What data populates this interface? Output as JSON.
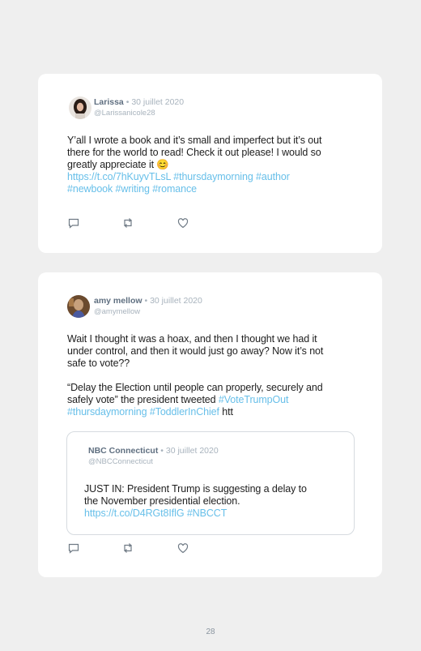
{
  "tweets": [
    {
      "author": "Larissa",
      "separator": "•",
      "date": "30 juillet 2020",
      "handle": "@Larissanicole28",
      "text_lines": [
        "Y’all I wrote a book and it’s small and imperfect but it’s out",
        "there for the world to read! Check it out please! I would so",
        "greatly appreciate it "
      ],
      "emoji": "😊",
      "link": "https://t.co/7hKuyvTLsL",
      "hashtags_line1": "#thursdaymorning #author",
      "hashtags_line2": "#newbook #writing #romance"
    },
    {
      "author": "amy mellow",
      "separator": "•",
      "date": "30 juillet 2020",
      "handle": "@amymellow",
      "text_lines": [
        "Wait I thought it was a hoax, and then I thought we had it",
        "under control, and then it would just go away? Now it’s not",
        "safe to vote??"
      ],
      "text2_line1": "“Delay the Election until people can properly, securely and",
      "text2_line2_start": "safely vote” the president tweeted ",
      "text2_hashtag1": "#VoteTrumpOut",
      "text2_hashtags_line3": "#thursdaymorning #ToddlerInChief",
      "text2_trailing": " htt",
      "quote": {
        "author": "NBC Connecticut",
        "separator": "•",
        "date": "30 juillet 2020",
        "handle": "@NBCConnecticut",
        "text_line1": "JUST IN: President Trump is suggesting a delay to",
        "text_line2": "the November presidential election.",
        "link": "https://t.co/D4RGt8IflG",
        "hashtag": "#NBCCT"
      }
    }
  ],
  "icons": [
    "reply-icon",
    "retweet-icon",
    "like-icon"
  ],
  "page_number": "28",
  "colors": {
    "link": "#67bfe9",
    "name": "#5f6f80",
    "meta": "#a8b3bd",
    "background": "#efefef"
  }
}
